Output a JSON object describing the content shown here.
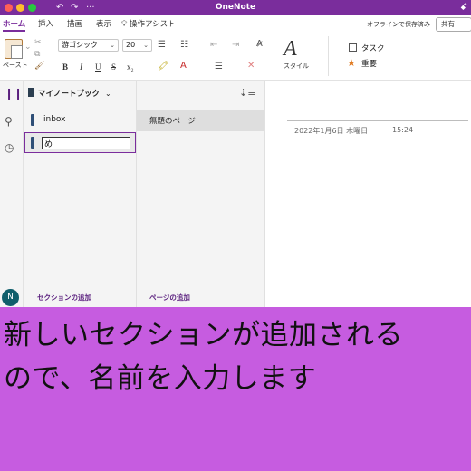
{
  "window": {
    "title": "OneNote",
    "toolbar_icons": {
      "undo": "↶",
      "redo": "↷",
      "more": "···"
    },
    "user_icon": "ꗃ"
  },
  "ribbon_tabs": [
    {
      "label": "ホーム",
      "active": true
    },
    {
      "label": "挿入",
      "active": false
    },
    {
      "label": "描画",
      "active": false
    },
    {
      "label": "表示",
      "active": false
    },
    {
      "label": "操作アシスト",
      "active": false
    }
  ],
  "offline_status": "オフラインで保存済み",
  "share_label": "共有",
  "ribbon": {
    "paste_label": "ペースト",
    "font_name": "游ゴシック",
    "font_size": "20",
    "format_buttons": [
      "B",
      "I",
      "U",
      "S",
      "x₂"
    ],
    "styles_label": "スタイル",
    "tags": [
      {
        "label": "タスク",
        "icon": "checkbox-icon"
      },
      {
        "label": "重要",
        "icon": "star-icon"
      }
    ]
  },
  "notebook": {
    "name": "マイノートブック",
    "sections": [
      {
        "label": "inbox"
      }
    ],
    "new_section_input": "め",
    "add_section_label": "セクションの追加"
  },
  "pages": {
    "items": [
      {
        "label": "無題のページ"
      }
    ],
    "add_page_label": "ページの追加"
  },
  "content": {
    "date": "2022年1月6日 木曜日",
    "time": "15:24"
  },
  "user": {
    "avatar_initial": "N"
  },
  "caption": {
    "line1": "新しいセクションが追加される",
    "line2": "ので、名前を入力します"
  },
  "colors": {
    "title_bar": "#7a2d9c",
    "caption_bg": "#c65ce0",
    "section_color": "#2f4f77",
    "accent": "#7a2d9c"
  }
}
